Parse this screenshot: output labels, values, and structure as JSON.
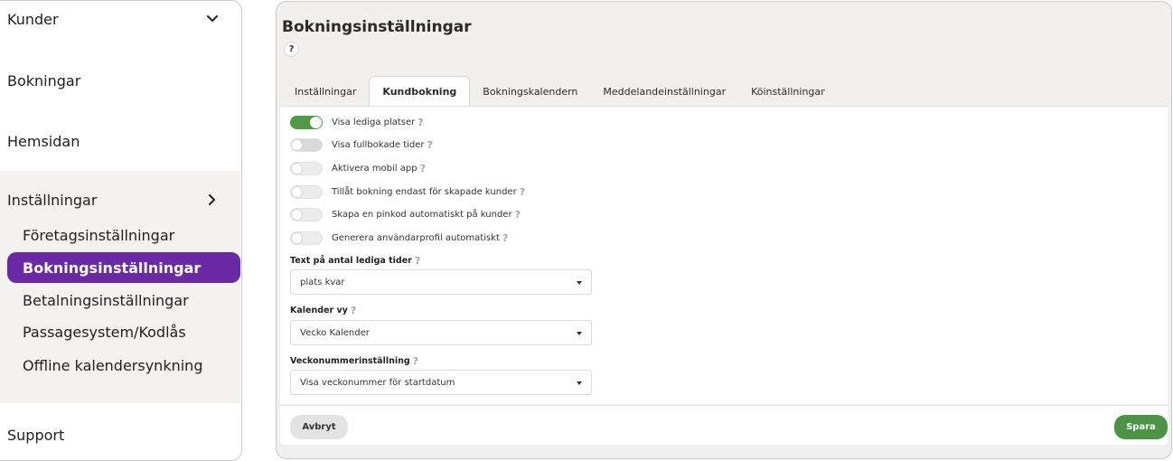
{
  "sidebar": {
    "items": [
      {
        "label": "Kunder"
      },
      {
        "label": "Bokningar"
      },
      {
        "label": "Hemsidan"
      },
      {
        "label": "Inställningar"
      },
      {
        "label": "Support"
      }
    ],
    "settings_sub": [
      {
        "label": "Företagsinställningar"
      },
      {
        "label": "Bokningsinställningar",
        "active": true
      },
      {
        "label": "Betalningsinställningar"
      },
      {
        "label": "Passagesystem/Kodlås"
      },
      {
        "label": "Offline kalendersynkning"
      }
    ],
    "accent_color": "#6a2aa5"
  },
  "main": {
    "title": "Bokningsinställningar",
    "help": "?",
    "tabs": [
      {
        "label": "Inställningar"
      },
      {
        "label": "Kundbokning",
        "active": true
      },
      {
        "label": "Bokningskalendern"
      },
      {
        "label": "Meddelandeinställningar"
      },
      {
        "label": "Köinställningar"
      }
    ],
    "toggles": [
      {
        "label": "Visa lediga platser",
        "state": "on"
      },
      {
        "label": "Visa fullbokade tider",
        "state": "off"
      },
      {
        "label": "Aktivera mobil app",
        "state": "off"
      },
      {
        "label": "Tillåt bokning endast för skapade kunder",
        "state": "off"
      },
      {
        "label": "Skapa en pinkod automatiskt på kunder",
        "state": "off"
      },
      {
        "label": "Generera användarprofil automatiskt",
        "state": "off"
      }
    ],
    "fields": [
      {
        "label": "Text på antal lediga tider",
        "value": "plats kvar"
      },
      {
        "label": "Kalender vy",
        "value": "Vecko Kalender"
      },
      {
        "label": "Veckonummerinställning",
        "value": "Visa veckonummer för startdatum"
      }
    ],
    "cancel_label": "Avbryt",
    "save_label": "Spara",
    "save_color": "#4b9446",
    "toggle_on_color": "#4f9a47"
  }
}
